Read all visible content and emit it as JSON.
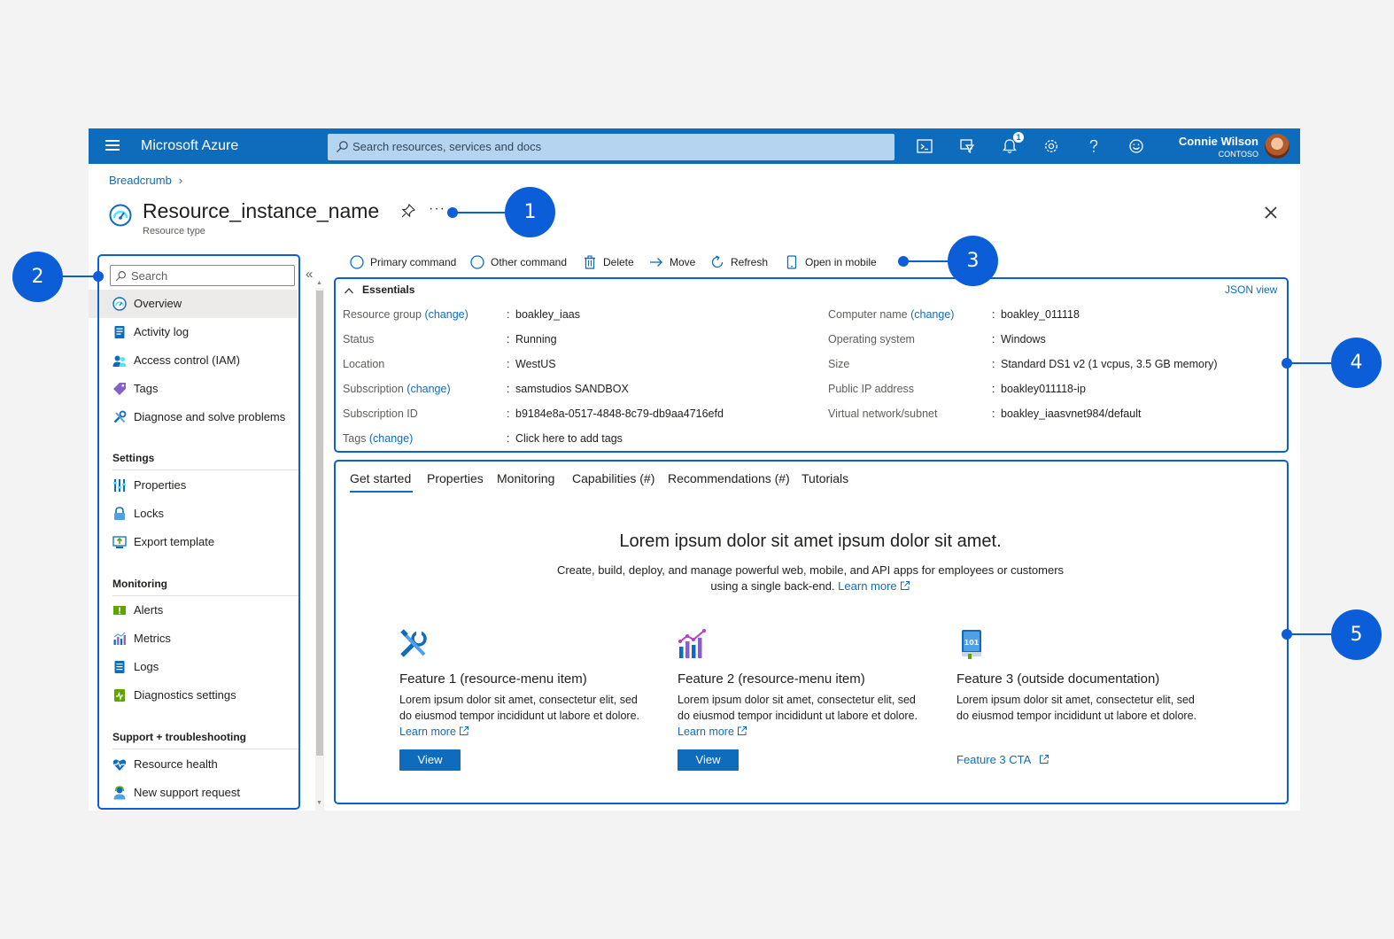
{
  "topbar": {
    "brand": "Microsoft Azure",
    "search_placeholder": "Search resources, services and docs",
    "notification_count": "1",
    "user_name": "Connie Wilson",
    "user_org": "CONTOSO",
    "icons": [
      "cloud-shell-icon",
      "directory-filter-icon",
      "notifications-icon",
      "settings-icon",
      "help-icon",
      "feedback-icon"
    ]
  },
  "header": {
    "breadcrumb": "Breadcrumb",
    "title": "Resource_instance_name",
    "more": "···",
    "subtitle": "Resource type"
  },
  "nav": {
    "search_placeholder": "Search",
    "collapse": "«",
    "items": [
      {
        "label": "Overview",
        "icon": "overview-icon"
      },
      {
        "label": "Activity log",
        "icon": "activity-log-icon"
      },
      {
        "label": "Access control (IAM)",
        "icon": "access-control-icon"
      },
      {
        "label": "Tags",
        "icon": "tags-icon"
      },
      {
        "label": "Diagnose and solve problems",
        "icon": "diagnose-icon"
      }
    ],
    "settings_heading": "Settings",
    "settings_items": [
      {
        "label": "Properties",
        "icon": "properties-icon"
      },
      {
        "label": "Locks",
        "icon": "locks-icon"
      },
      {
        "label": "Export template",
        "icon": "export-template-icon"
      }
    ],
    "monitoring_heading": "Monitoring",
    "monitoring_items": [
      {
        "label": "Alerts",
        "icon": "alerts-icon"
      },
      {
        "label": "Metrics",
        "icon": "metrics-icon"
      },
      {
        "label": "Logs",
        "icon": "logs-icon"
      },
      {
        "label": "Diagnostics settings",
        "icon": "diagnostics-settings-icon"
      }
    ],
    "support_heading": "Support + troubleshooting",
    "support_items": [
      {
        "label": "Resource health",
        "icon": "resource-health-icon"
      },
      {
        "label": "New support request",
        "icon": "support-request-icon"
      }
    ]
  },
  "commands": {
    "primary": "Primary command",
    "other": "Other command",
    "delete": "Delete",
    "move": "Move",
    "refresh": "Refresh",
    "open_mobile": "Open in mobile"
  },
  "essentials": {
    "heading": "Essentials",
    "json_view": "JSON view",
    "change": "(change)",
    "colon": ":",
    "left": [
      {
        "label": "Resource group",
        "value": "boakley_iaas"
      },
      {
        "label": "Status",
        "value": "Running"
      },
      {
        "label": "Location",
        "value": "WestUS"
      },
      {
        "label": "Subscription",
        "value": "samstudios SANDBOX"
      },
      {
        "label": "Subscription ID",
        "value": "b9184e8a-0517-4848-8c79-db9aa4716efd"
      },
      {
        "label": "Tags",
        "value": "Click here to add tags"
      }
    ],
    "right": [
      {
        "label": "Computer name",
        "value": "boakley_011118"
      },
      {
        "label": "Operating system",
        "value": "Windows"
      },
      {
        "label": "Size",
        "value": "Standard DS1 v2 (1 vcpus, 3.5 GB memory)"
      },
      {
        "label": "Public IP address",
        "value": "boakley011118-ip"
      },
      {
        "label": "Virtual network/subnet",
        "value": "boakley_iaasvnet984/default"
      }
    ]
  },
  "tabs": [
    "Get started",
    "Properties",
    "Monitoring",
    "Capabilities (#)",
    "Recommendations (#)",
    "Tutorials"
  ],
  "get_started": {
    "title": "Lorem ipsum dolor sit amet ipsum dolor sit amet.",
    "desc_line1": "Create, build, deploy, and manage powerful web, mobile, and API apps for employees or customers",
    "desc_line2": "using a single back-end.",
    "learn_more": "Learn more",
    "features": [
      {
        "title": "Feature 1 (resource-menu item)",
        "desc": "Lorem ipsum dolor sit amet, consectetur elit, sed do eiusmod tempor incididunt ut labore et dolore.",
        "link": "Learn more",
        "button": "View",
        "icon": "tools-icon"
      },
      {
        "title": "Feature 2 (resource-menu item)",
        "desc": "Lorem ipsum dolor sit amet, consectetur elit, sed do eiusmod tempor incididunt ut labore et dolore.",
        "link": "Learn more",
        "button": "View",
        "icon": "metrics-chart-icon"
      },
      {
        "title": "Feature 3 (outside documentation)",
        "desc": "Lorem ipsum dolor sit amet, consectetur elit, sed do eiusmod tempor incididunt ut labore et dolore.",
        "cta": "Feature 3 CTA",
        "icon": "book-101-icon"
      }
    ]
  },
  "callouts": [
    "1",
    "2",
    "3",
    "4",
    "5"
  ],
  "colors": {
    "accent": "#0f6cbd",
    "annotation": "#0b5ed7"
  }
}
